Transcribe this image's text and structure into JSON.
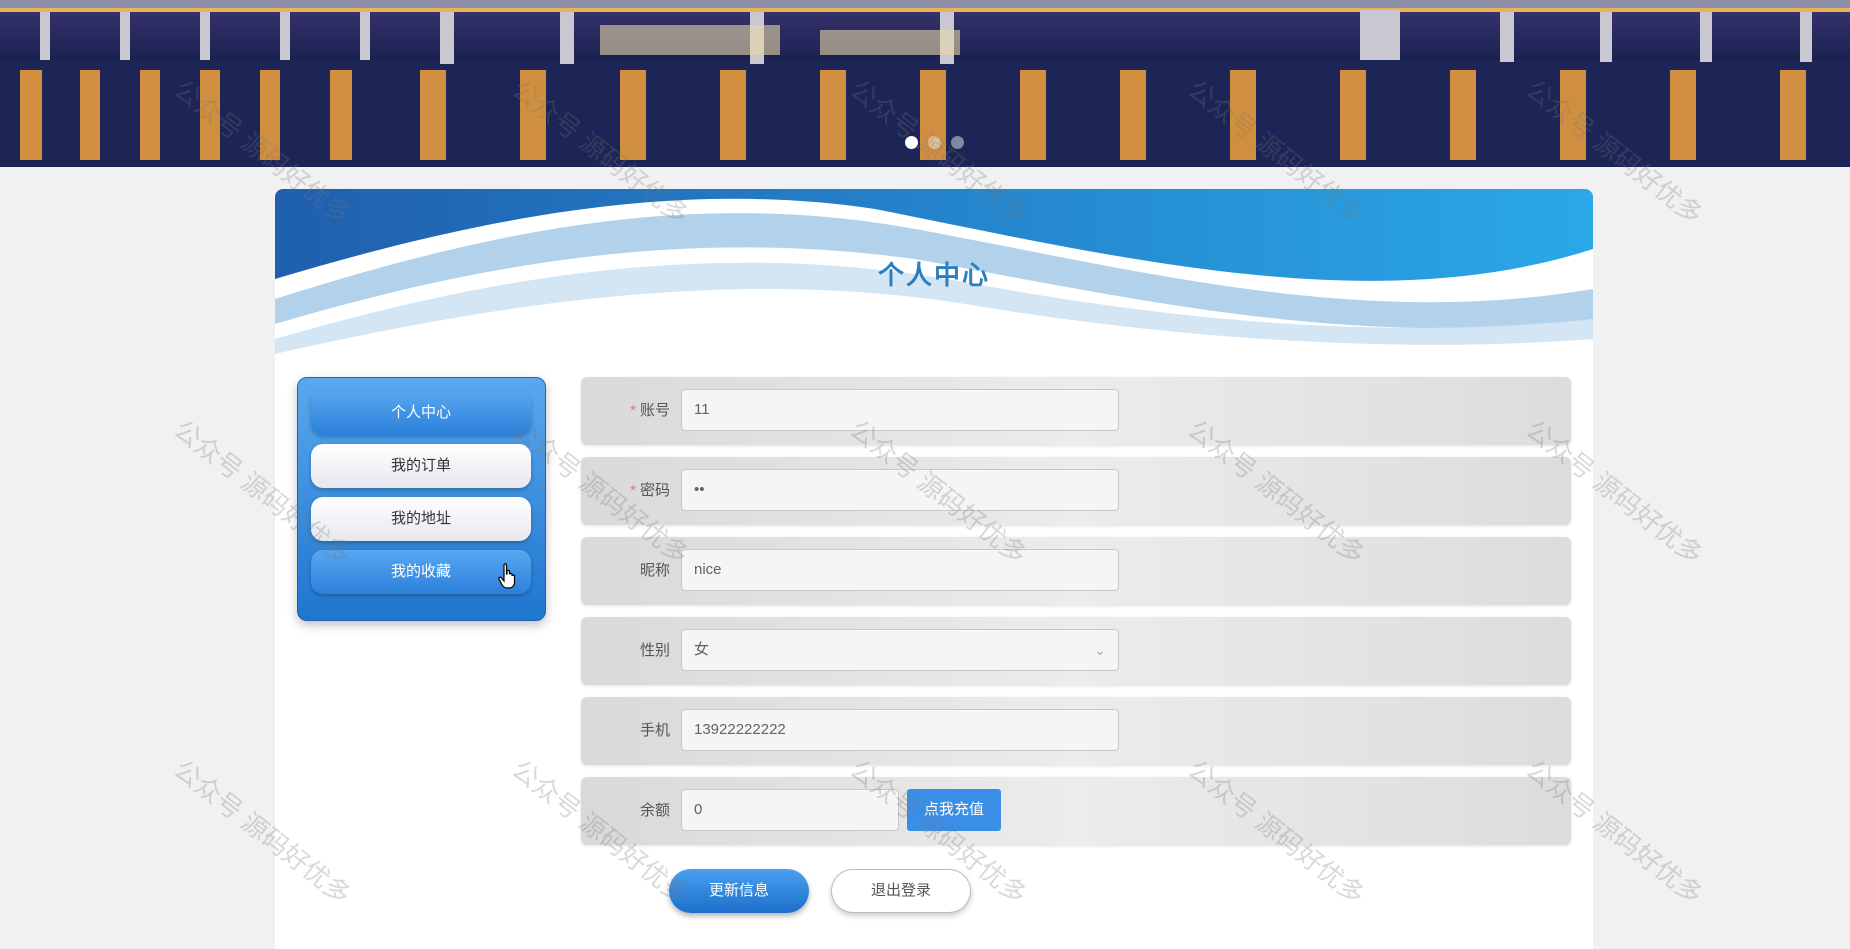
{
  "banner": {
    "slides": 3,
    "active_slide": 1
  },
  "page": {
    "title": "个人中心"
  },
  "menu": {
    "items": [
      {
        "label": "个人中心",
        "active": true
      },
      {
        "label": "我的订单",
        "active": false
      },
      {
        "label": "我的地址",
        "active": false
      },
      {
        "label": "我的收藏",
        "active": false,
        "hovered": true
      }
    ]
  },
  "form": {
    "account": {
      "label": "账号",
      "required": true,
      "value": "11"
    },
    "password": {
      "label": "密码",
      "required": true,
      "value": "••"
    },
    "nickname": {
      "label": "昵称",
      "value": "nice"
    },
    "gender": {
      "label": "性别",
      "value": "女"
    },
    "phone": {
      "label": "手机",
      "value": "13922222222"
    },
    "balance": {
      "label": "余额",
      "value": "0",
      "recharge_label": "点我充值"
    }
  },
  "actions": {
    "update_label": "更新信息",
    "logout_label": "退出登录"
  },
  "watermark": "公众号 源码好优多",
  "colors": {
    "accent": "#2b7fbf",
    "primary": "#3a8ee6",
    "required": "#f56c6c"
  }
}
